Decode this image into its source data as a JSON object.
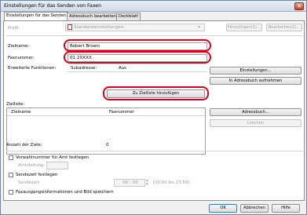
{
  "window": {
    "title": "Einstellungen für das Senden von Faxen",
    "close_glyph": "✕"
  },
  "tabs": [
    {
      "label": "Einstellungen für das Senden"
    },
    {
      "label": "Adressbuch bearbeiten"
    },
    {
      "label": "Deckblatt"
    }
  ],
  "profile": {
    "label": "Profil:",
    "value": "Standardeinstellungen",
    "add_button": "Hinzufügen(1)...",
    "edit_button": "Bearbeiten(2)..."
  },
  "recipient": {
    "name_label": "Zielname:",
    "name_value": "Robert Brown",
    "fax_label": "Faxnummer:",
    "fax_value": "01 2XXXX",
    "ext_label": "Erweiterte Funktionen:",
    "subaddress_label": "Subadresse:",
    "subaddress_value": "Aus",
    "settings_button": "Einstellungen...",
    "add_to_addressbook_button": "In Adressbuch aufnehmen",
    "add_to_list_button": "Zu Zielliste hinzufügen"
  },
  "destination_list": {
    "label": "Zielliste:",
    "columns": [
      "Zielname",
      "Faxnummer"
    ],
    "addressbook_button": "Adressbuch...",
    "delete_button": "Löschen",
    "count_label": "Anzahl der Ziele:",
    "count_value": "0"
  },
  "options": {
    "outside_dial_label": "Vorwahlnummer für Amt festlegen",
    "outside_line_label": "Amtsleitung:",
    "send_time_label": "Sendezeit festlegen",
    "send_time_field_label": "Sendezeit:",
    "send_time_value": "00 : 00",
    "send_time_range": "[00:00 bis 23:59]",
    "save_info_label": "Faxausgangsinformationen und Bild speichern"
  },
  "footer": {
    "ok": "OK",
    "cancel": "Abbrechen",
    "help": "Hilfe"
  }
}
